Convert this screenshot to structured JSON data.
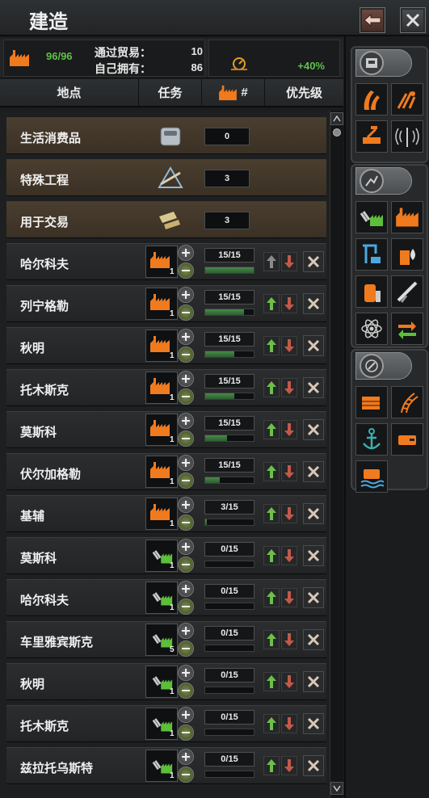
{
  "window": {
    "title": "建造",
    "back_icon": "back-arrow-icon",
    "close_icon": "close-icon"
  },
  "summary": {
    "factory_ratio": "96/96",
    "trade_label": "通过贸易：",
    "trade_value": "10",
    "owned_label": "自己拥有：",
    "owned_value": "86",
    "speed_bonus": "+40%"
  },
  "columns": {
    "location": "地点",
    "task": "任务",
    "factory_count": "#",
    "priority": "优先级"
  },
  "special_rows": [
    {
      "label": "生活消费品",
      "count": "0",
      "icon": "consumer-goods-icon"
    },
    {
      "label": "特殊工程",
      "count": "3",
      "icon": "special-projects-icon"
    },
    {
      "label": "用于交易",
      "count": "3",
      "icon": "trade-icon"
    }
  ],
  "construction_rows": [
    {
      "location": "哈尔科夫",
      "type": "civilian-factory",
      "level": "1",
      "progress": "15/15",
      "fill": 1.0
    },
    {
      "location": "列宁格勒",
      "type": "civilian-factory",
      "level": "1",
      "progress": "15/15",
      "fill": 0.8
    },
    {
      "location": "秋明",
      "type": "civilian-factory",
      "level": "1",
      "progress": "15/15",
      "fill": 0.6
    },
    {
      "location": "托木斯克",
      "type": "civilian-factory",
      "level": "1",
      "progress": "15/15",
      "fill": 0.6
    },
    {
      "location": "莫斯科",
      "type": "civilian-factory",
      "level": "1",
      "progress": "15/15",
      "fill": 0.45
    },
    {
      "location": "伏尔加格勒",
      "type": "civilian-factory",
      "level": "1",
      "progress": "15/15",
      "fill": 0.3
    },
    {
      "location": "基辅",
      "type": "civilian-factory",
      "level": "1",
      "progress": "3/15",
      "fill": 0.04
    },
    {
      "location": "莫斯科",
      "type": "military-factory",
      "level": "1",
      "progress": "0/15",
      "fill": 0
    },
    {
      "location": "哈尔科夫",
      "type": "military-factory",
      "level": "1",
      "progress": "0/15",
      "fill": 0
    },
    {
      "location": "车里雅宾斯克",
      "type": "military-factory",
      "level": "5",
      "progress": "0/15",
      "fill": 0
    },
    {
      "location": "秋明",
      "type": "military-factory",
      "level": "1",
      "progress": "0/15",
      "fill": 0
    },
    {
      "location": "托木斯克",
      "type": "military-factory",
      "level": "1",
      "progress": "0/15",
      "fill": 0
    },
    {
      "location": "兹拉托乌斯特",
      "type": "military-factory",
      "level": "1",
      "progress": "0/15",
      "fill": 0
    }
  ],
  "sidebar": [
    {
      "group": "defense",
      "icon": "fortification-group-icon",
      "buttons": [
        "air-base-icon",
        "anti-air-icon",
        "coastal-fort-icon",
        "radar-icon"
      ]
    },
    {
      "group": "industry",
      "icon": "industry-group-icon",
      "buttons": [
        "military-factory-icon",
        "civilian-factory-icon",
        "naval-dockyard-icon",
        "synthetic-refinery-icon",
        "fuel-silo-icon",
        "rocket-site-icon",
        "nuclear-reactor-icon",
        "infrastructure-icon"
      ]
    },
    {
      "group": "logistics",
      "icon": "logistics-group-icon",
      "buttons": [
        "supply-hub-icon",
        "railway-icon",
        "naval-base-icon",
        "land-fort-icon",
        "coastal-bunker-icon"
      ]
    }
  ],
  "colors": {
    "accent_green": "#5fc04a",
    "factory_orange": "#f07a1e",
    "military_green": "#5cbf3a"
  }
}
